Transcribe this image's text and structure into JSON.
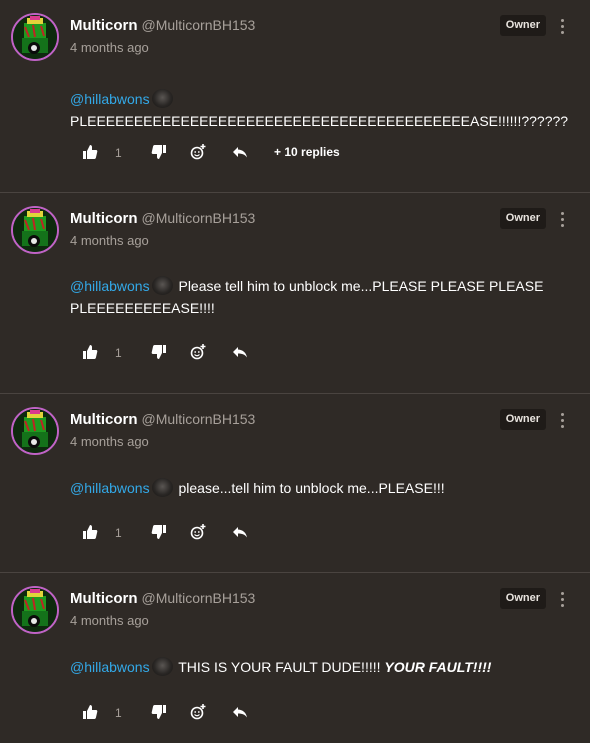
{
  "comments": [
    {
      "author": "Multicorn",
      "handle": "@MulticornBH153",
      "time": "4 months ago",
      "badge": "Owner",
      "mention": "@hillabwons",
      "text_after_mention": "",
      "text_line2": "PLEEEEEEEEEEEEEEEEEEEEEEEEEEEEEEEEEEEEEEEEEASE!!!!!!??????",
      "likes": "1",
      "replies": "+ 10 replies"
    },
    {
      "author": "Multicorn",
      "handle": "@MulticornBH153",
      "time": "4 months ago",
      "badge": "Owner",
      "mention": "@hillabwons",
      "text_after_mention": "Please tell him to unblock me...PLEASE PLEASE PLEASE PLEEEEEEEEEASE!!!!",
      "likes": "1"
    },
    {
      "author": "Multicorn",
      "handle": "@MulticornBH153",
      "time": "4 months ago",
      "badge": "Owner",
      "mention": "@hillabwons",
      "text_after_mention": "please...tell him to unblock me...PLEASE!!!",
      "likes": "1"
    },
    {
      "author": "Multicorn",
      "handle": "@MulticornBH153",
      "time": "4 months ago",
      "badge": "Owner",
      "mention": "@hillabwons",
      "text_after_mention": "THIS IS YOUR FAULT DUDE!!!!!",
      "text_emphasis": "YOUR FAULT!!!!",
      "likes": "1"
    }
  ],
  "icons": {
    "like": "thumbs-up-icon",
    "dislike": "thumbs-down-icon",
    "react": "add-reaction-icon",
    "reply": "reply-arrow-icon",
    "more": "more-vertical-icon"
  },
  "colors": {
    "background": "#2f2a26",
    "mention": "#33a9e8",
    "avatar_ring": "#c063c6",
    "badge_bg": "#1f1b18"
  }
}
